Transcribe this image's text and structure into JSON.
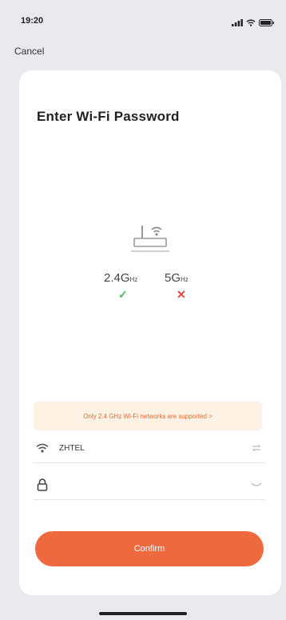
{
  "status_bar": {
    "time": "19:20"
  },
  "nav": {
    "cancel_label": "Cancel"
  },
  "page": {
    "title": "Enter Wi-Fi Password"
  },
  "bands": {
    "band_24": {
      "value": "2.4G",
      "unit": "Hz",
      "supported": true
    },
    "band_5": {
      "value": "5G",
      "unit": "Hz",
      "supported": false
    }
  },
  "notice": {
    "text": "Only 2.4 GHz Wi-Fi networks are supported >"
  },
  "form": {
    "ssid_value": "ZHTEL",
    "password_value": "",
    "password_placeholder": ""
  },
  "confirm": {
    "label": "Confirm"
  },
  "colors": {
    "accent": "#ee6a3e",
    "notice_background": "#fdf2e4",
    "notice_text": "#e26a2c",
    "check": "#4cbb5a",
    "cross": "#e6463a"
  },
  "icons": {
    "signal": "signal-icon",
    "wifi_status": "wifi-status-icon",
    "battery": "battery-icon",
    "router": "router-icon",
    "wifi_field": "wifi-icon",
    "lock": "lock-icon",
    "eye": "eye-closed-icon",
    "switch": "switch-network-icon"
  }
}
